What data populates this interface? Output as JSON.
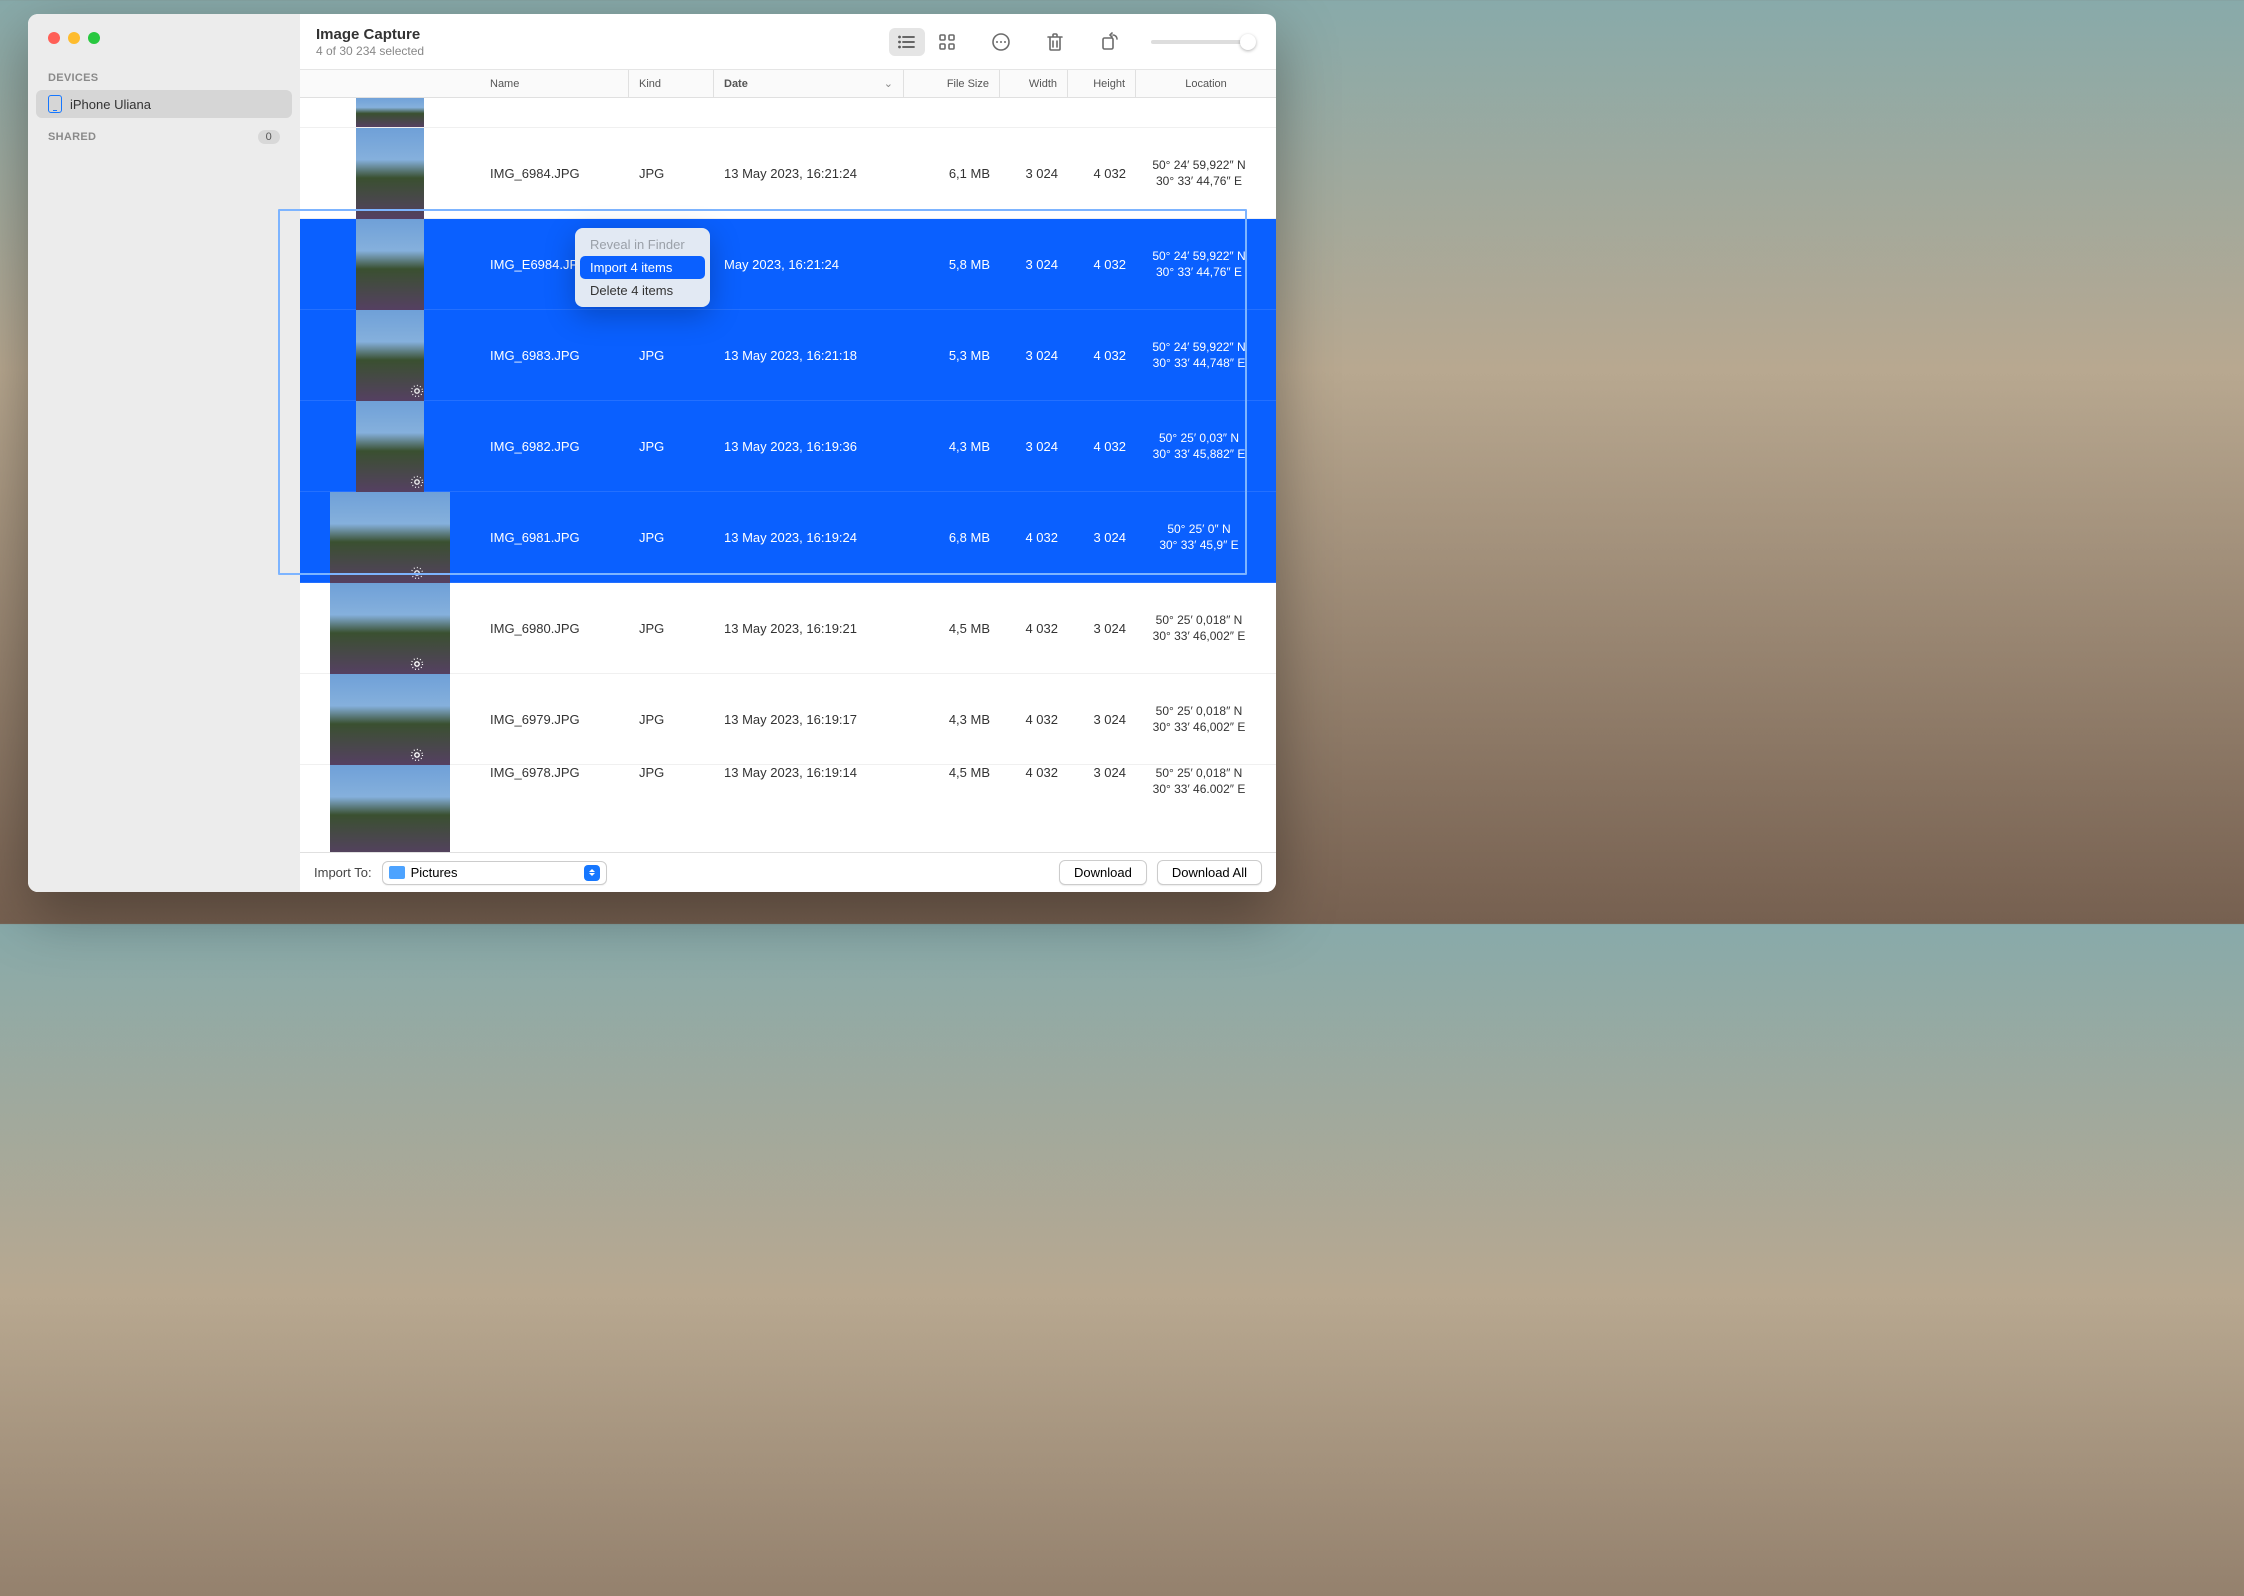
{
  "header": {
    "title": "Image Capture",
    "subtitle": "4 of 30 234 selected"
  },
  "sidebar": {
    "devices_label": "DEVICES",
    "shared_label": "SHARED",
    "shared_count": "0",
    "device_name": "iPhone Uliana"
  },
  "columns": {
    "name": "Name",
    "kind": "Kind",
    "date": "Date",
    "size": "File Size",
    "width": "Width",
    "height": "Height",
    "location": "Location"
  },
  "rows": [
    {
      "name": "",
      "kind": "",
      "date": "",
      "size": "",
      "w": "",
      "h": "",
      "loc1": "",
      "loc2": "",
      "sel": false,
      "partial": true
    },
    {
      "name": "IMG_6984.JPG",
      "kind": "JPG",
      "date": "13 May 2023, 16:21:24",
      "size": "6,1 MB",
      "w": "3 024",
      "h": "4 032",
      "loc1": "50° 24′ 59,922″ N",
      "loc2": "30° 33′ 44,76″ E",
      "sel": false
    },
    {
      "name": "IMG_E6984.JP",
      "kind": "",
      "date": "May 2023, 16:21:24",
      "size": "5,8 MB",
      "w": "3 024",
      "h": "4 032",
      "loc1": "50° 24′ 59,922″ N",
      "loc2": "30° 33′ 44,76″ E",
      "sel": true
    },
    {
      "name": "IMG_6983.JPG",
      "kind": "JPG",
      "date": "13 May 2023, 16:21:18",
      "size": "5,3 MB",
      "w": "3 024",
      "h": "4 032",
      "loc1": "50° 24′ 59,922″ N",
      "loc2": "30° 33′ 44,748″ E",
      "sel": true,
      "live": true
    },
    {
      "name": "IMG_6982.JPG",
      "kind": "JPG",
      "date": "13 May 2023, 16:19:36",
      "size": "4,3 MB",
      "w": "3 024",
      "h": "4 032",
      "loc1": "50° 25′ 0,03″ N",
      "loc2": "30° 33′ 45,882″ E",
      "sel": true,
      "live": true
    },
    {
      "name": "IMG_6981.JPG",
      "kind": "JPG",
      "date": "13 May 2023, 16:19:24",
      "size": "6,8 MB",
      "w": "4 032",
      "h": "3 024",
      "loc1": "50° 25′ 0″ N",
      "loc2": "30° 33′ 45,9″ E",
      "sel": true,
      "live": true,
      "wide": true
    },
    {
      "name": "IMG_6980.JPG",
      "kind": "JPG",
      "date": "13 May 2023, 16:19:21",
      "size": "4,5 MB",
      "w": "4 032",
      "h": "3 024",
      "loc1": "50° 25′ 0,018″ N",
      "loc2": "30° 33′ 46,002″ E",
      "sel": false,
      "live": true,
      "wide": true
    },
    {
      "name": "IMG_6979.JPG",
      "kind": "JPG",
      "date": "13 May 2023, 16:19:17",
      "size": "4,3 MB",
      "w": "4 032",
      "h": "3 024",
      "loc1": "50° 25′ 0,018″ N",
      "loc2": "30° 33′ 46,002″ E",
      "sel": false,
      "live": true,
      "wide": true
    },
    {
      "name": "IMG_6978.JPG",
      "kind": "JPG",
      "date": "13 May 2023, 16:19:14",
      "size": "4,5 MB",
      "w": "4 032",
      "h": "3 024",
      "loc1": "50° 25′ 0,018″ N",
      "loc2": "30° 33′ 46.002″ E",
      "sel": false,
      "wide": true,
      "partial_bot": true
    }
  ],
  "context_menu": {
    "reveal": "Reveal in Finder",
    "import": "Import 4 items",
    "delete": "Delete 4 items"
  },
  "footer": {
    "import_to_label": "Import To:",
    "destination": "Pictures",
    "download": "Download",
    "download_all": "Download All"
  }
}
